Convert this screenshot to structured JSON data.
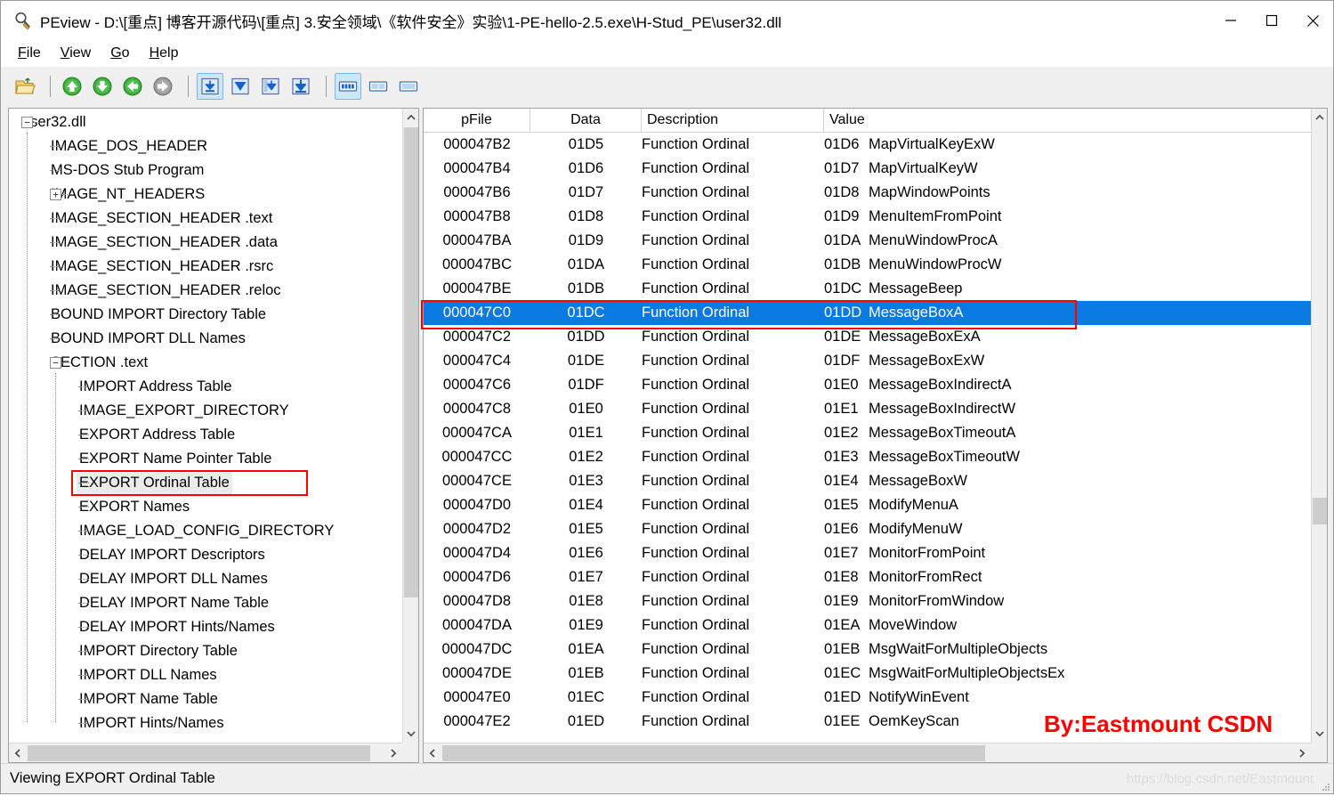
{
  "window": {
    "title": "PEview - D:\\[重点] 博客开源代码\\[重点] 3.安全领域\\《软件安全》实验\\1-PE-hello-2.5.exe\\H-Stud_PE\\user32.dll",
    "app_icon": "magnifier-icon",
    "minimize_label": "—",
    "maximize_label": "□",
    "close_label": "✕"
  },
  "menubar": {
    "items": [
      {
        "label": "File",
        "accel": "F"
      },
      {
        "label": "View",
        "accel": "V"
      },
      {
        "label": "Go",
        "accel": "G"
      },
      {
        "label": "Help",
        "accel": "H"
      }
    ]
  },
  "toolbar": {
    "buttons": [
      {
        "name": "open-file-icon",
        "active": false
      },
      {
        "name": "separator",
        "active": false
      },
      {
        "name": "arrow-up-icon",
        "active": false
      },
      {
        "name": "arrow-down-icon",
        "active": false
      },
      {
        "name": "arrow-back-icon",
        "active": false
      },
      {
        "name": "arrow-forward-icon",
        "active": false
      },
      {
        "name": "separator",
        "active": false
      },
      {
        "name": "view-hex-icon",
        "active": true
      },
      {
        "name": "view-collapse-icon",
        "active": false
      },
      {
        "name": "view-expand-icon",
        "active": false
      },
      {
        "name": "view-drilldown-icon",
        "active": false
      },
      {
        "name": "separator",
        "active": false
      },
      {
        "name": "layout-columns-icon",
        "active": true
      },
      {
        "name": "layout-split-icon",
        "active": false
      },
      {
        "name": "layout-single-icon",
        "active": false
      }
    ]
  },
  "tree": {
    "nodes": [
      {
        "label": "user32.dll",
        "level": 0,
        "toggle": "minus",
        "selected": false
      },
      {
        "label": "IMAGE_DOS_HEADER",
        "level": 1,
        "toggle": "none",
        "selected": false
      },
      {
        "label": "MS-DOS Stub Program",
        "level": 1,
        "toggle": "none",
        "selected": false
      },
      {
        "label": "IMAGE_NT_HEADERS",
        "level": 1,
        "toggle": "plus",
        "selected": false
      },
      {
        "label": "IMAGE_SECTION_HEADER .text",
        "level": 1,
        "toggle": "none",
        "selected": false
      },
      {
        "label": "IMAGE_SECTION_HEADER .data",
        "level": 1,
        "toggle": "none",
        "selected": false
      },
      {
        "label": "IMAGE_SECTION_HEADER .rsrc",
        "level": 1,
        "toggle": "none",
        "selected": false
      },
      {
        "label": "IMAGE_SECTION_HEADER .reloc",
        "level": 1,
        "toggle": "none",
        "selected": false
      },
      {
        "label": "BOUND IMPORT Directory Table",
        "level": 1,
        "toggle": "none",
        "selected": false
      },
      {
        "label": "BOUND IMPORT DLL Names",
        "level": 1,
        "toggle": "none",
        "selected": false
      },
      {
        "label": "SECTION .text",
        "level": 1,
        "toggle": "minus",
        "selected": false
      },
      {
        "label": "IMPORT Address Table",
        "level": 2,
        "toggle": "none",
        "selected": false
      },
      {
        "label": "IMAGE_EXPORT_DIRECTORY",
        "level": 2,
        "toggle": "none",
        "selected": false
      },
      {
        "label": "EXPORT Address Table",
        "level": 2,
        "toggle": "none",
        "selected": false
      },
      {
        "label": "EXPORT Name Pointer Table",
        "level": 2,
        "toggle": "none",
        "selected": false
      },
      {
        "label": "EXPORT Ordinal Table",
        "level": 2,
        "toggle": "none",
        "selected": true
      },
      {
        "label": "EXPORT Names",
        "level": 2,
        "toggle": "none",
        "selected": false
      },
      {
        "label": "IMAGE_LOAD_CONFIG_DIRECTORY",
        "level": 2,
        "toggle": "none",
        "selected": false
      },
      {
        "label": "DELAY IMPORT Descriptors",
        "level": 2,
        "toggle": "none",
        "selected": false
      },
      {
        "label": "DELAY IMPORT DLL Names",
        "level": 2,
        "toggle": "none",
        "selected": false
      },
      {
        "label": "DELAY IMPORT Name Table",
        "level": 2,
        "toggle": "none",
        "selected": false
      },
      {
        "label": "DELAY IMPORT Hints/Names",
        "level": 2,
        "toggle": "none",
        "selected": false
      },
      {
        "label": "IMPORT Directory Table",
        "level": 2,
        "toggle": "none",
        "selected": false
      },
      {
        "label": "IMPORT DLL Names",
        "level": 2,
        "toggle": "none",
        "selected": false
      },
      {
        "label": "IMPORT Name Table",
        "level": 2,
        "toggle": "none",
        "selected": false
      },
      {
        "label": "IMPORT Hints/Names",
        "level": 2,
        "toggle": "none",
        "selected": false
      }
    ]
  },
  "list": {
    "columns": [
      {
        "label": "pFile",
        "key": "pfile"
      },
      {
        "label": "Data",
        "key": "data"
      },
      {
        "label": "Description",
        "key": "description"
      },
      {
        "label": "Value",
        "key": "value"
      }
    ],
    "rows": [
      {
        "pfile": "000047B2",
        "data": "01D5",
        "description": "Function Ordinal",
        "ordinal": "01D6",
        "name": "MapVirtualKeyExW",
        "selected": false
      },
      {
        "pfile": "000047B4",
        "data": "01D6",
        "description": "Function Ordinal",
        "ordinal": "01D7",
        "name": "MapVirtualKeyW",
        "selected": false
      },
      {
        "pfile": "000047B6",
        "data": "01D7",
        "description": "Function Ordinal",
        "ordinal": "01D8",
        "name": "MapWindowPoints",
        "selected": false
      },
      {
        "pfile": "000047B8",
        "data": "01D8",
        "description": "Function Ordinal",
        "ordinal": "01D9",
        "name": "MenuItemFromPoint",
        "selected": false
      },
      {
        "pfile": "000047BA",
        "data": "01D9",
        "description": "Function Ordinal",
        "ordinal": "01DA",
        "name": "MenuWindowProcA",
        "selected": false
      },
      {
        "pfile": "000047BC",
        "data": "01DA",
        "description": "Function Ordinal",
        "ordinal": "01DB",
        "name": "MenuWindowProcW",
        "selected": false
      },
      {
        "pfile": "000047BE",
        "data": "01DB",
        "description": "Function Ordinal",
        "ordinal": "01DC",
        "name": "MessageBeep",
        "selected": false
      },
      {
        "pfile": "000047C0",
        "data": "01DC",
        "description": "Function Ordinal",
        "ordinal": "01DD",
        "name": "MessageBoxA",
        "selected": true
      },
      {
        "pfile": "000047C2",
        "data": "01DD",
        "description": "Function Ordinal",
        "ordinal": "01DE",
        "name": "MessageBoxExA",
        "selected": false
      },
      {
        "pfile": "000047C4",
        "data": "01DE",
        "description": "Function Ordinal",
        "ordinal": "01DF",
        "name": "MessageBoxExW",
        "selected": false
      },
      {
        "pfile": "000047C6",
        "data": "01DF",
        "description": "Function Ordinal",
        "ordinal": "01E0",
        "name": "MessageBoxIndirectA",
        "selected": false
      },
      {
        "pfile": "000047C8",
        "data": "01E0",
        "description": "Function Ordinal",
        "ordinal": "01E1",
        "name": "MessageBoxIndirectW",
        "selected": false
      },
      {
        "pfile": "000047CA",
        "data": "01E1",
        "description": "Function Ordinal",
        "ordinal": "01E2",
        "name": "MessageBoxTimeoutA",
        "selected": false
      },
      {
        "pfile": "000047CC",
        "data": "01E2",
        "description": "Function Ordinal",
        "ordinal": "01E3",
        "name": "MessageBoxTimeoutW",
        "selected": false
      },
      {
        "pfile": "000047CE",
        "data": "01E3",
        "description": "Function Ordinal",
        "ordinal": "01E4",
        "name": "MessageBoxW",
        "selected": false
      },
      {
        "pfile": "000047D0",
        "data": "01E4",
        "description": "Function Ordinal",
        "ordinal": "01E5",
        "name": "ModifyMenuA",
        "selected": false
      },
      {
        "pfile": "000047D2",
        "data": "01E5",
        "description": "Function Ordinal",
        "ordinal": "01E6",
        "name": "ModifyMenuW",
        "selected": false
      },
      {
        "pfile": "000047D4",
        "data": "01E6",
        "description": "Function Ordinal",
        "ordinal": "01E7",
        "name": "MonitorFromPoint",
        "selected": false
      },
      {
        "pfile": "000047D6",
        "data": "01E7",
        "description": "Function Ordinal",
        "ordinal": "01E8",
        "name": "MonitorFromRect",
        "selected": false
      },
      {
        "pfile": "000047D8",
        "data": "01E8",
        "description": "Function Ordinal",
        "ordinal": "01E9",
        "name": "MonitorFromWindow",
        "selected": false
      },
      {
        "pfile": "000047DA",
        "data": "01E9",
        "description": "Function Ordinal",
        "ordinal": "01EA",
        "name": "MoveWindow",
        "selected": false
      },
      {
        "pfile": "000047DC",
        "data": "01EA",
        "description": "Function Ordinal",
        "ordinal": "01EB",
        "name": "MsgWaitForMultipleObjects",
        "selected": false
      },
      {
        "pfile": "000047DE",
        "data": "01EB",
        "description": "Function Ordinal",
        "ordinal": "01EC",
        "name": "MsgWaitForMultipleObjectsEx",
        "selected": false
      },
      {
        "pfile": "000047E0",
        "data": "01EC",
        "description": "Function Ordinal",
        "ordinal": "01ED",
        "name": "NotifyWinEvent",
        "selected": false
      },
      {
        "pfile": "000047E2",
        "data": "01ED",
        "description": "Function Ordinal",
        "ordinal": "01EE",
        "name": "OemKeyScan",
        "selected": false
      }
    ]
  },
  "statusbar": {
    "text": "Viewing EXPORT Ordinal Table",
    "watermark": "https://blog.csdn.net/Eastmount"
  },
  "annotations": {
    "watermark_text": "By:Eastmount CSDN",
    "watermark_color": "#ff0000",
    "box_color": "#ff0000"
  },
  "colors": {
    "selection_blue": "#0a7ae0",
    "toolbar_active": "#cce8f6",
    "window_bg": "#f0f0f0"
  }
}
